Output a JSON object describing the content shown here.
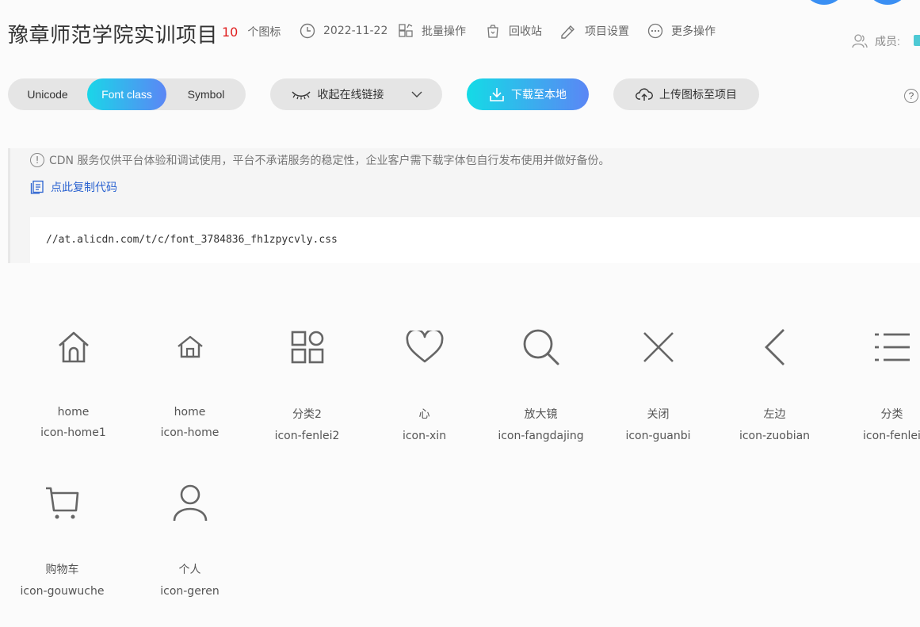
{
  "header": {
    "title": "豫章师范学院实训项目",
    "icon_count": "10",
    "icon_count_label": "个图标",
    "date": "2022-11-22",
    "batch_label": "批量操作",
    "recycle_label": "回收站",
    "settings_label": "项目设置",
    "more_label": "更多操作",
    "members_label": "成员:"
  },
  "toolbar": {
    "tabs": [
      "Unicode",
      "Font class",
      "Symbol"
    ],
    "active_tab": "Font class",
    "collapse_label": "收起在线链接",
    "download_label": "下载至本地",
    "upload_label": "上传图标至项目",
    "help_label": "?"
  },
  "cdn": {
    "notice": "CDN 服务仅供平台体验和调试使用，平台不承诺服务的稳定性，企业客户需下载字体包自行发布使用并做好备份。",
    "copy_label": "点此复制代码",
    "url": "//at.alicdn.com/t/c/font_3784836_fh1zpycvly.css"
  },
  "icons": [
    {
      "name": "home",
      "class": "icon-home1",
      "glyph": "home-icon"
    },
    {
      "name": "home",
      "class": "icon-home",
      "glyph": "home-small-icon"
    },
    {
      "name": "分类2",
      "class": "icon-fenlei2",
      "glyph": "category-grid-icon"
    },
    {
      "name": "心",
      "class": "icon-xin",
      "glyph": "heart-icon"
    },
    {
      "name": "放大镜",
      "class": "icon-fangdajing",
      "glyph": "search-icon"
    },
    {
      "name": "关闭",
      "class": "icon-guanbi",
      "glyph": "close-icon"
    },
    {
      "name": "左边",
      "class": "icon-zuobian",
      "glyph": "chevron-left-icon"
    },
    {
      "name": "分类",
      "class": "icon-fenlei",
      "glyph": "list-icon"
    },
    {
      "name": "购物车",
      "class": "icon-gouwuche",
      "glyph": "cart-icon"
    },
    {
      "name": "个人",
      "class": "icon-geren",
      "glyph": "user-icon"
    }
  ],
  "colors": {
    "accent_gradient_start": "#14dbe6",
    "accent_gradient_end": "#5b86f5",
    "count_red": "#e02020",
    "link_blue": "#2a62d0"
  }
}
